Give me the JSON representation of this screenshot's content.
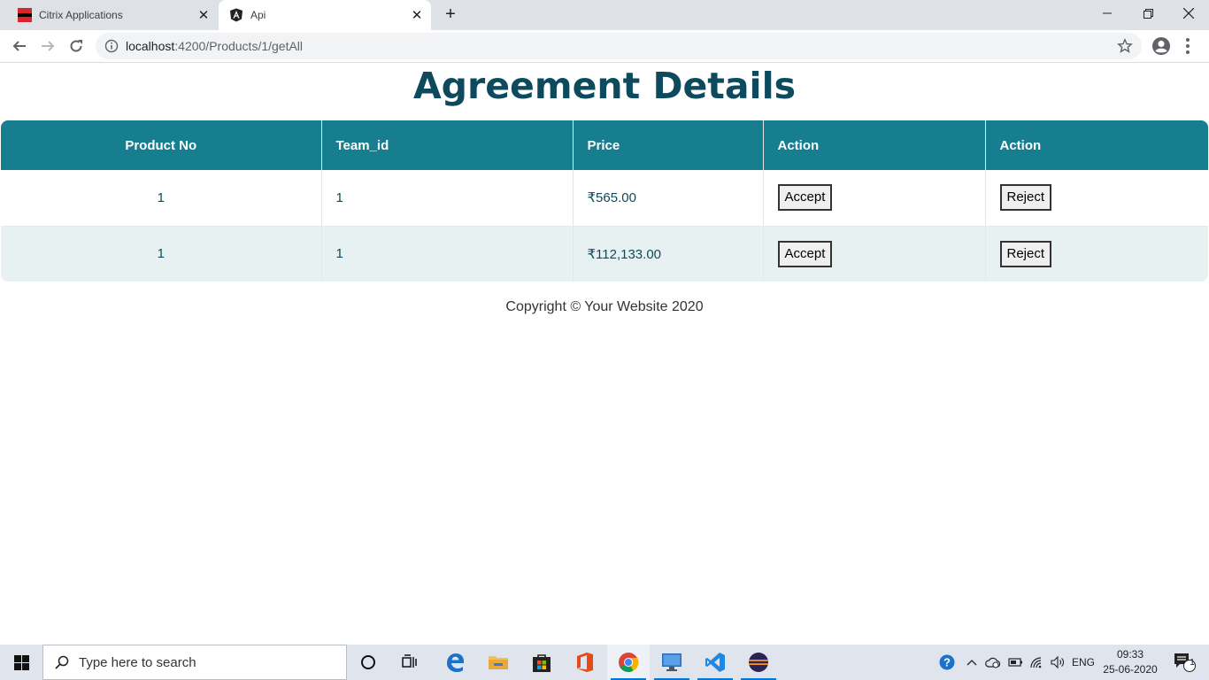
{
  "browser": {
    "tabs": [
      {
        "title": "Citrix Applications",
        "favicon": "citrix-icon",
        "active": false
      },
      {
        "title": "Api",
        "favicon": "angular-icon",
        "active": true
      }
    ],
    "url_host": "localhost",
    "url_rest": ":4200/Products/1/getAll"
  },
  "page": {
    "title": "Agreement Details",
    "columns": [
      "Product No",
      "Team_id",
      "Price",
      "Action",
      "Action"
    ],
    "rows": [
      {
        "product_no": "1",
        "team_id": "1",
        "price": "₹565.00",
        "accept": "Accept",
        "reject": "Reject"
      },
      {
        "product_no": "1",
        "team_id": "1",
        "price": "₹112,133.00",
        "accept": "Accept",
        "reject": "Reject"
      }
    ],
    "footer": "Copyright © Your Website 2020"
  },
  "taskbar": {
    "search_placeholder": "Type here to search",
    "language": "ENG",
    "time": "09:33",
    "date": "25-06-2020",
    "notification_count": "1"
  },
  "colors": {
    "header_bg": "#177e8f",
    "title_color": "#0d4a5e",
    "row_alt_bg": "#e8f1f2"
  }
}
